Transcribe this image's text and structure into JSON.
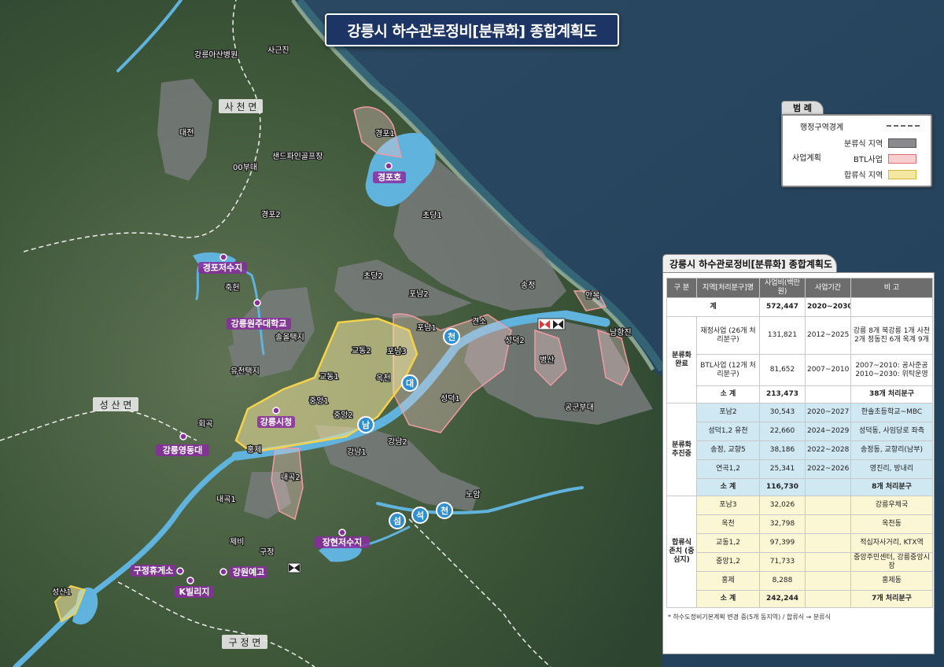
{
  "title": "강릉시 하수관로정비[분류화] 종합계획도",
  "legend": {
    "tab": "범 례",
    "boundary_label": "행정구역경계",
    "plan_label": "사업계획",
    "separate_label": "분류식 지역",
    "btl_label": "BTL사업",
    "combined_label": "합류식 지역",
    "colors": {
      "separate": "#8a8a8e",
      "btl": "#f7cfcf",
      "combined": "#f4e7a1",
      "boundary": "#ffffff"
    }
  },
  "map": {
    "places": [
      "강릉아산병원",
      "사근진",
      "대전",
      "00부대",
      "샌드파인골프장",
      "경포1",
      "경포2",
      "초당1",
      "초당2",
      "포남2",
      "송정",
      "안목",
      "포남1",
      "견소",
      "성덕2",
      "남항진",
      "병산",
      "공군부대",
      "성덕1",
      "옥천",
      "교동1",
      "교동2",
      "포남3",
      "중앙1",
      "중앙2",
      "홍제",
      "강남1",
      "강남2",
      "내곡2",
      "노암",
      "내곡1",
      "제비",
      "구정",
      "회곡",
      "유천택지",
      "솔올택지",
      "죽헌",
      "성산1"
    ],
    "districts": [
      "사 천 면",
      "성 산 면",
      "구 정 면"
    ],
    "pois": [
      "경포호",
      "경포저수지",
      "강릉원주대학교",
      "강릉시청",
      "강릉영동대",
      "장현저수지",
      "구정휴게소",
      "강원예고",
      "K빌리지"
    ],
    "river_chars": [
      "천",
      "대",
      "남",
      "섬",
      "석",
      "천"
    ]
  },
  "panel": {
    "title": "강릉시 하수관로정비[분류화] 종합계획도",
    "headers": [
      "구 분",
      "지역[처리분구]명",
      "사업비(백만원)",
      "사업기간",
      "비 고"
    ],
    "total": {
      "label": "계",
      "cost": "572,447",
      "period": "2020~2030",
      "note": ""
    },
    "groups": [
      {
        "name": "분류화 완료",
        "rows": [
          {
            "area": "재정사업 (26개 처리분구)",
            "cost": "131,821",
            "period": "2012~2025",
            "note": "강릉 8개 북강릉 1개 사천 2개 정동진 6개 옥계 9개"
          },
          {
            "area": "BTL사업 (12개 처리분구)",
            "cost": "81,652",
            "period": "2007~2010",
            "note": "2007~2010: 공사준공 2010~2030: 위탁운영"
          }
        ],
        "subtotal": {
          "label": "소 계",
          "cost": "213,473",
          "note": "38개 처리분구"
        }
      },
      {
        "name": "분류화 추진중",
        "rows": [
          {
            "area": "포남2",
            "cost": "30,543",
            "period": "2020~2027",
            "note": "한솔초등학교~MBC"
          },
          {
            "area": "성덕1,2 유천",
            "cost": "22,660",
            "period": "2024~2029",
            "note": "성덕동, 사임당로 좌측"
          },
          {
            "area": "송정, 교향5",
            "cost": "38,186",
            "period": "2022~2028",
            "note": "송정동, 교항리(남부)"
          },
          {
            "area": "연곡1,2",
            "cost": "25,341",
            "period": "2022~2026",
            "note": "영진리, 방내리"
          }
        ],
        "subtotal": {
          "label": "소 계",
          "cost": "116,730",
          "note": "8개 처리분구"
        }
      },
      {
        "name": "합류식 존치 (중심지)",
        "rows": [
          {
            "area": "포남3",
            "cost": "32,026",
            "period": "",
            "note": "강릉우체국"
          },
          {
            "area": "옥천",
            "cost": "32,798",
            "period": "",
            "note": "옥천동"
          },
          {
            "area": "교동1,2",
            "cost": "97,399",
            "period": "",
            "note": "적십자사거리, KTX역"
          },
          {
            "area": "중앙1,2",
            "cost": "71,733",
            "period": "",
            "note": "중앙주민센터, 강릉중앙시장"
          },
          {
            "area": "홍제",
            "cost": "8,288",
            "period": "",
            "note": "홍제동"
          }
        ],
        "subtotal": {
          "label": "소 계",
          "cost": "242,244",
          "note": "7개 처리분구"
        }
      }
    ],
    "footnote": "* 하수도정비기본계획 변경 중(5개 동지역) / 합류식 → 분류식"
  }
}
